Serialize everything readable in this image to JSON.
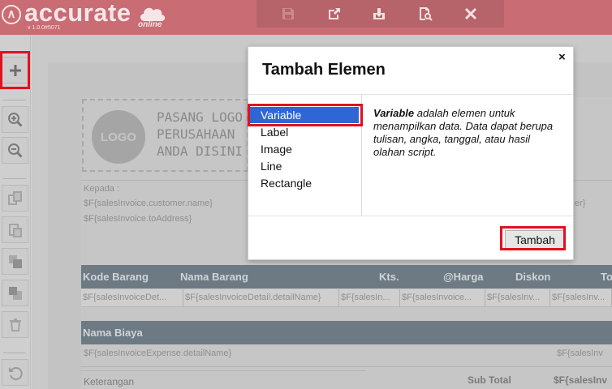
{
  "header": {
    "logo_text": "accurate",
    "logo_sub": "online",
    "version": "v 1.0.0#5071",
    "toolbar": [
      {
        "icon": "save-icon"
      },
      {
        "icon": "export-icon"
      },
      {
        "icon": "download-icon"
      },
      {
        "icon": "preview-icon"
      },
      {
        "icon": "close-icon"
      }
    ]
  },
  "sidebar": {
    "buttons": [
      {
        "icon": "plus-icon"
      },
      {
        "icon": "zoom-in-icon"
      },
      {
        "icon": "zoom-out-icon"
      },
      {
        "icon": "copy-icon"
      },
      {
        "icon": "paste-icon"
      },
      {
        "icon": "bring-front-icon"
      },
      {
        "icon": "send-back-icon"
      },
      {
        "icon": "trash-icon"
      },
      {
        "icon": "undo-icon"
      }
    ]
  },
  "canvas": {
    "logo_circle": "LOGO",
    "logo_placeholder": "PASANG LOGO\nPERUSAHAAN\nANDA DISINI",
    "kepada_label": "Kepada :",
    "customer_field": "$F{salesInvoice.customer.name}",
    "address_field": "$F{salesInvoice.toAddress}",
    "right_field_fragment": "er}",
    "item_headers": [
      "Kode Barang",
      "Nama Barang",
      "Kts.",
      "@Harga",
      "Diskon",
      "To"
    ],
    "item_cells": [
      "$F{salesInvoiceDet...",
      "$F{salesInvoiceDetail.detailName}",
      "$F{salesIn...",
      "$F{salesInvoice...",
      "$F{salesInv...",
      "$F{salesInv..."
    ],
    "expense_header": "Nama Biaya",
    "expense_cell": "$F{salesInvoiceExpense.detailName}",
    "expense_right": "$F{salesInv",
    "keterangan": "Keterangan",
    "sub_total": "Sub Total",
    "sub_total_field": "$F{salesInv"
  },
  "dialog": {
    "title": "Tambah Elemen",
    "close": "×",
    "items": [
      "Variable",
      "Label",
      "Image",
      "Line",
      "Rectangle"
    ],
    "selected": "Variable",
    "description_term": "Variable",
    "description_rest": " adalah elemen untuk menampilkan data. Data dapat berupa tulisan, angka, tanggal, atau hasil olahan script.",
    "add_button": "Tambah"
  },
  "colors": {
    "header": "#c96c74",
    "highlight": "#e3101e",
    "selection": "#2f66d6",
    "band": "#6d7a84"
  }
}
